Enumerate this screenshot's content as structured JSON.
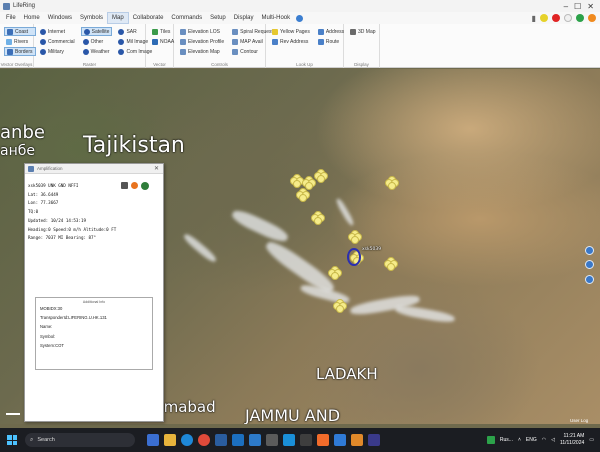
{
  "window": {
    "title": "LifeRing"
  },
  "menu": {
    "items": [
      "File",
      "Home",
      "Windows",
      "Symbols",
      "Map",
      "Collaborate",
      "Commands",
      "Setup",
      "Display",
      "Multi-Hook"
    ],
    "active": "Map"
  },
  "ribbon": {
    "groups": [
      {
        "name": "Vector Overlays",
        "items": [
          {
            "label": "Coast",
            "selected": true
          },
          {
            "label": "Rivers",
            "selected": false
          },
          {
            "label": "Borders",
            "selected": true
          }
        ]
      },
      {
        "name": "Raster",
        "items": [
          {
            "label": "Internet"
          },
          {
            "label": "Commercial"
          },
          {
            "label": "Military"
          },
          {
            "label": "Satellite",
            "selected": true
          },
          {
            "label": "Other"
          },
          {
            "label": "Weather"
          },
          {
            "label": "SAR"
          },
          {
            "label": "Mil Image"
          },
          {
            "label": "Com Image"
          }
        ]
      },
      {
        "name": "Vector",
        "items": [
          {
            "label": "Tiles"
          },
          {
            "label": "NOAA"
          }
        ]
      },
      {
        "name": "Controls",
        "items": [
          {
            "label": "Elevation LOS"
          },
          {
            "label": "Elevation Profile"
          },
          {
            "label": "Elevation Map"
          },
          {
            "label": "Spiral Request"
          },
          {
            "label": "MAP Avail"
          },
          {
            "label": "Contour"
          }
        ]
      },
      {
        "name": "Look Up",
        "items": [
          {
            "label": "Yellow Pages"
          },
          {
            "label": "Rev Address"
          },
          {
            "label": "Address"
          },
          {
            "label": "Route"
          }
        ]
      },
      {
        "name": "Display",
        "items": [
          {
            "label": "3D Map"
          }
        ]
      }
    ]
  },
  "map": {
    "labels": {
      "tajikistan": "Tajikistan",
      "anbe": "anbe",
      "cyrillic": "анбе",
      "ladakh": "LADAKH",
      "islamabad": "Islamabad",
      "jammu": "JAMMU AND",
      "callsign": "xsk5039"
    },
    "user_log": "User Log"
  },
  "amplification": {
    "title": "Amplification",
    "lines": [
      "xsk5039 UNK GND NFFI",
      "Lat: 36.6449",
      "Lon: 77.3667",
      "TQ:0",
      "Updated: 10/24 14:53:19",
      "Heading:0 Speed:0 m/h Altitude:0 FT",
      "Range: 7037 MI Bearing: 87°"
    ],
    "panel": {
      "header": "Additional Info",
      "lines": [
        "MOBIDX:30",
        "TransponderId:LIFERING.U.HK.131",
        "Name:",
        "Symbol:",
        "System:COT"
      ]
    }
  },
  "taskbar": {
    "search_placeholder": "Search",
    "task_label": "Rus...",
    "lang": "ENG",
    "time": "11:21 AM",
    "date": "11/11/2024"
  }
}
